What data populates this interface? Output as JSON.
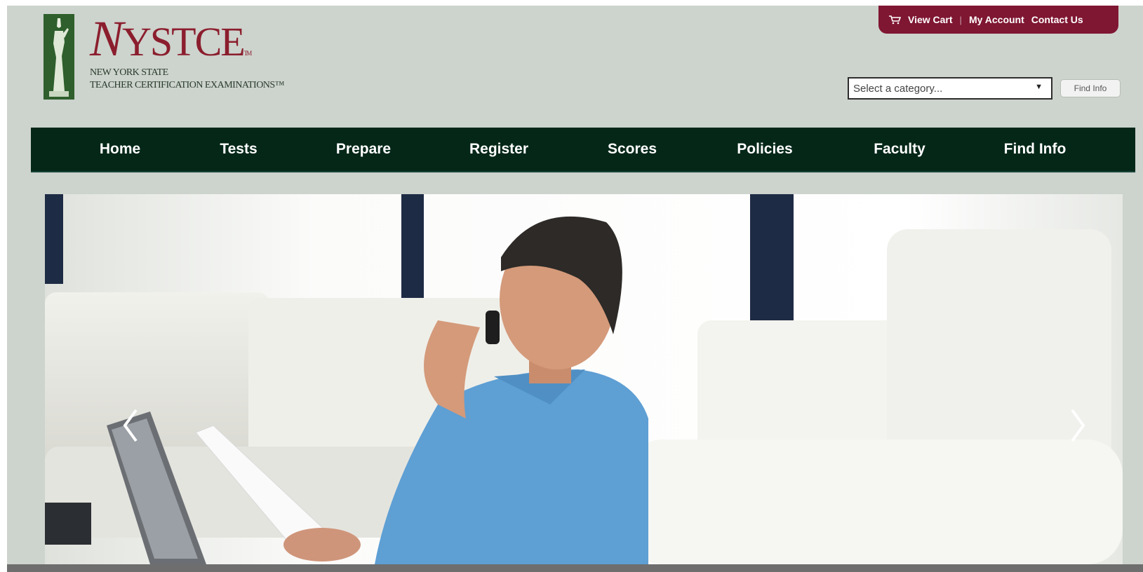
{
  "logo": {
    "name_first": "N",
    "name_rest": "YSTCE",
    "tm": "TM",
    "subtitle_line1": "NEW YORK STATE",
    "subtitle_line2": "TEACHER CERTIFICATION EXAMINATIONS™"
  },
  "utility": {
    "cart_icon": "cart-icon",
    "view_cart": "View Cart",
    "separator": "|",
    "my_account": "My Account",
    "contact_us": "Contact Us"
  },
  "search": {
    "category_value": "Select a category...",
    "find_button": "Find Info"
  },
  "nav": [
    "Home",
    "Tests",
    "Prepare",
    "Register",
    "Scores",
    "Policies",
    "Faculty",
    "Find Info"
  ],
  "hero": {
    "prev_icon": "chevron-left-icon",
    "next_icon": "chevron-right-icon"
  },
  "colors": {
    "page_bg": "#cdd3cd",
    "brand_red": "#7f1632",
    "nav_green": "#042718",
    "logo_green": "#2e5f2c"
  }
}
